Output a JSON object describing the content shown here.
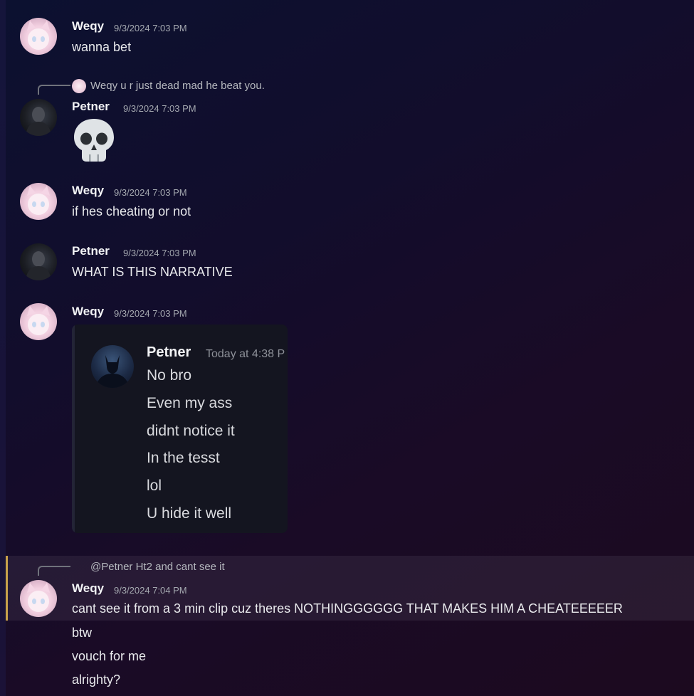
{
  "messages": [
    {
      "author": "Weqy",
      "timestamp": "9/3/2024 7:03 PM",
      "lines": [
        "wanna bet"
      ]
    },
    {
      "reply": {
        "author": "Weqy",
        "text": "u r just dead mad he beat you."
      },
      "author": "Petner",
      "timestamp": "9/3/2024 7:03 PM",
      "emoji": "skull-emoji"
    },
    {
      "author": "Weqy",
      "timestamp": "9/3/2024 7:03 PM",
      "lines": [
        "if hes cheating or not"
      ]
    },
    {
      "author": "Petner",
      "timestamp": "9/3/2024 7:03 PM",
      "lines": [
        "WHAT IS THIS NARRATIVE"
      ]
    },
    {
      "author": "Weqy",
      "timestamp": "9/3/2024 7:03 PM",
      "embed": {
        "author": "Petner",
        "timestamp": "Today at 4:38 P",
        "lines": [
          "No bro",
          "Even my ass",
          "didnt notice it",
          "In the tesst",
          "lol",
          "U hide it well"
        ]
      }
    },
    {
      "reply": {
        "author": "@Petner",
        "text": "Ht2 and cant see it"
      },
      "author": "Weqy",
      "timestamp": "9/3/2024 7:04 PM",
      "highlighted": true,
      "lines": [
        "cant see it from a 3 min clip cuz theres NOTHINGGGGGG THAT MAKES HIM A CHEATEEEEER",
        "btw",
        "vouch for me",
        "alrighty?"
      ]
    }
  ],
  "colors": {
    "highlight_border": "#c9a24a",
    "background": "#120d2c"
  }
}
